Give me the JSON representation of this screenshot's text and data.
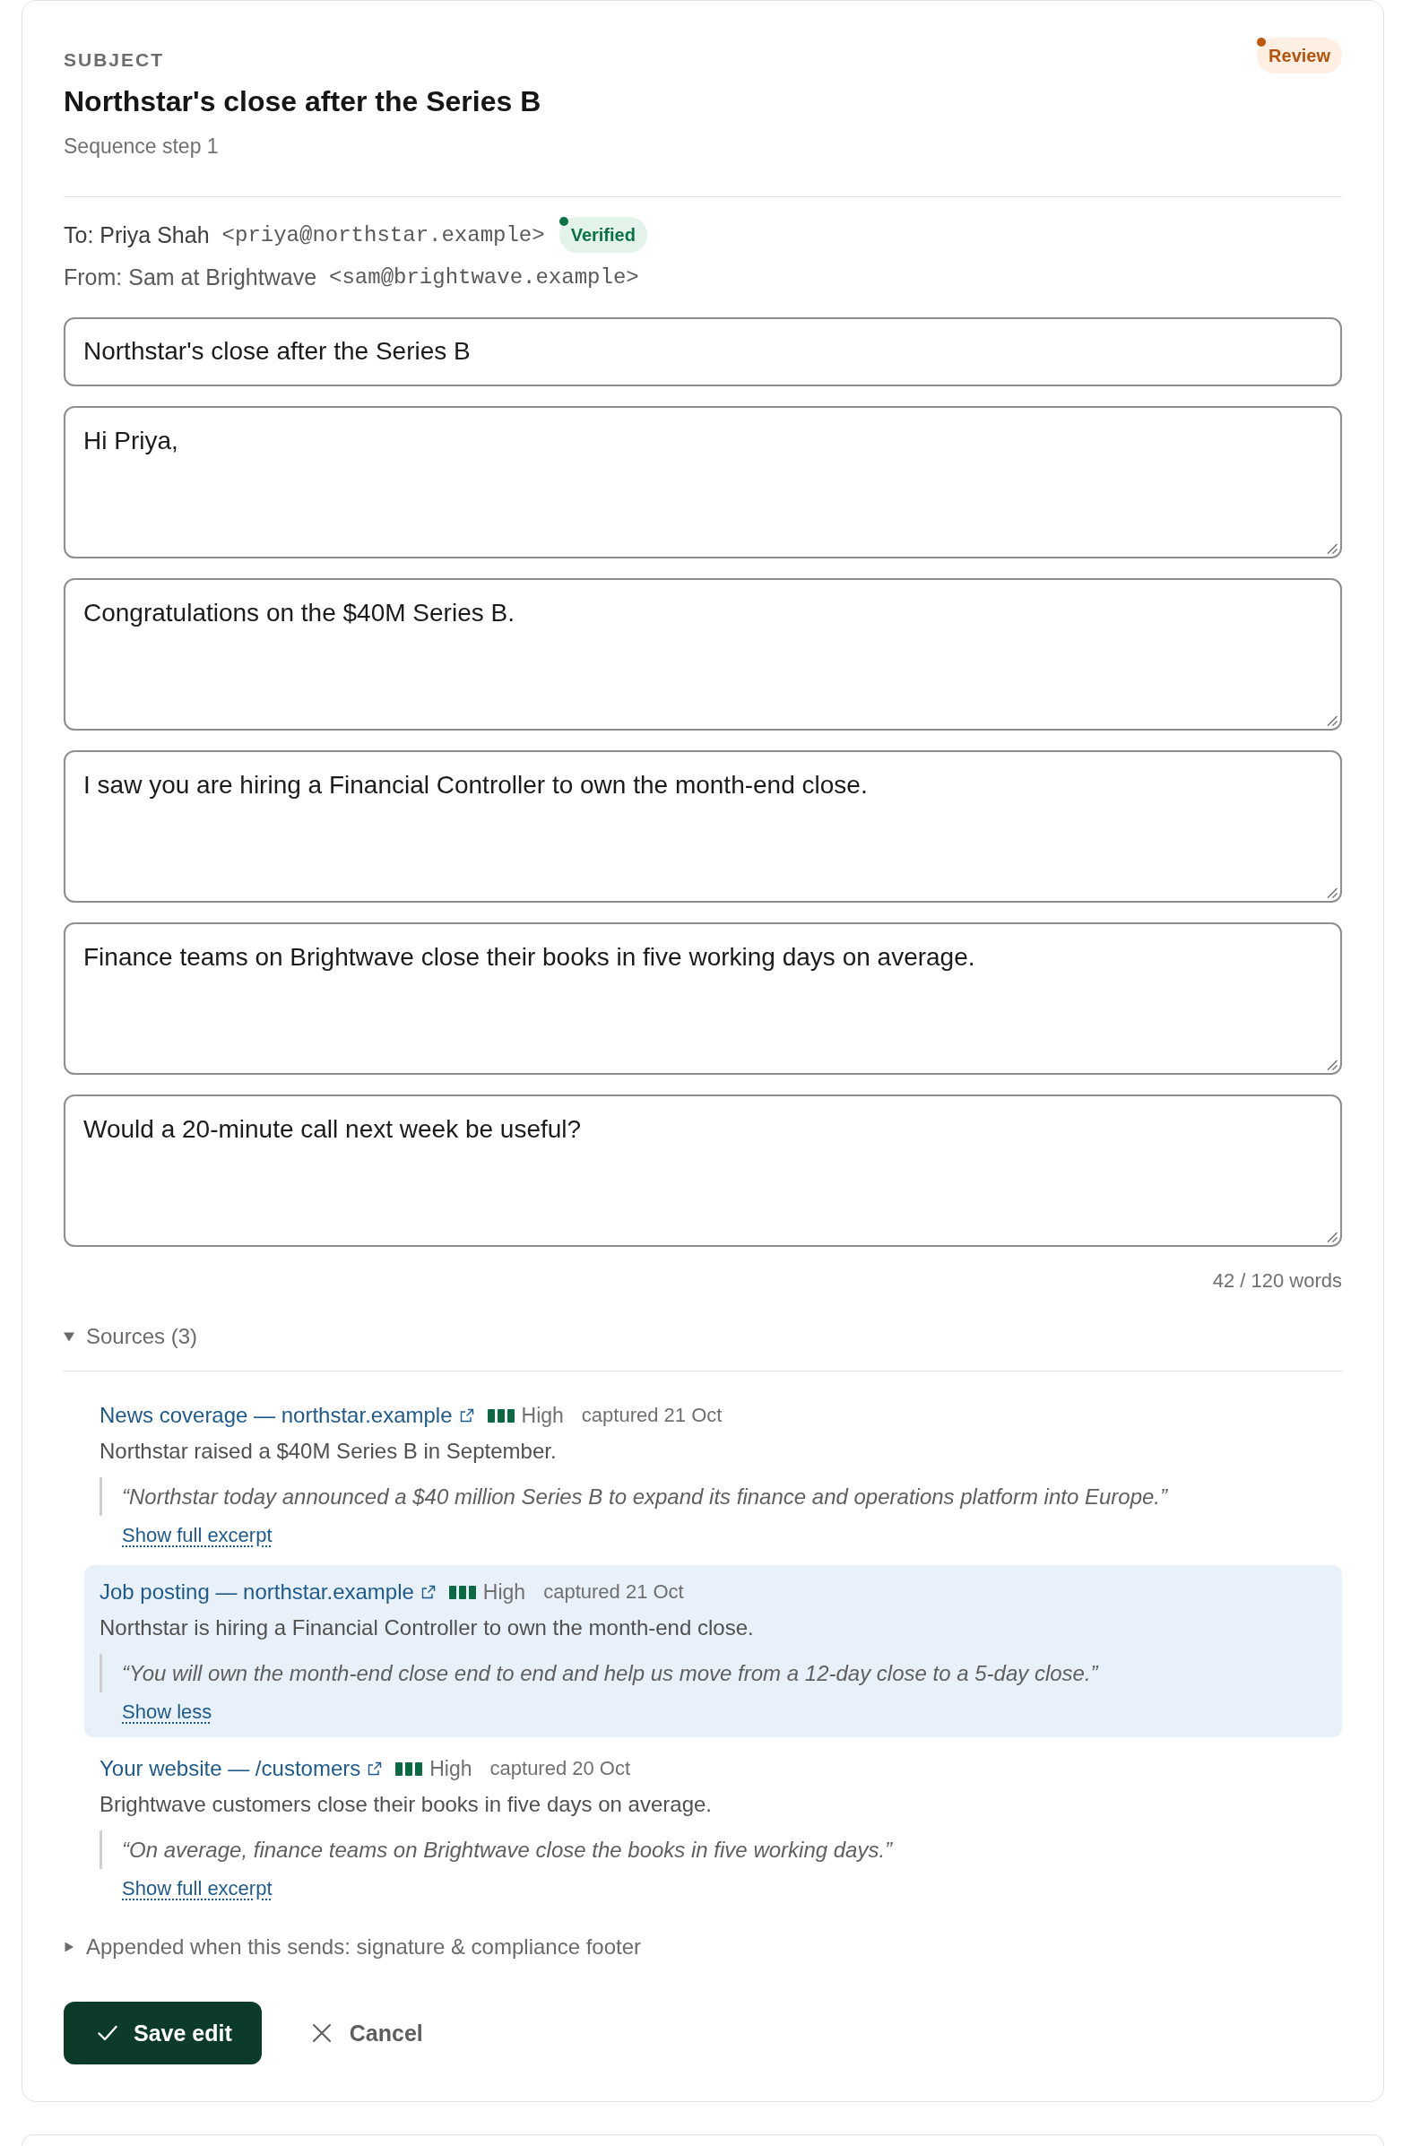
{
  "header": {
    "label": "SUBJECT",
    "title": "Northstar's close after the Series B",
    "subtitle": "Sequence step 1",
    "status": {
      "text": "Review",
      "kind": "review"
    }
  },
  "recipients": {
    "to": {
      "name": "To: Priya Shah",
      "email": "<priya@northstar.example>",
      "badge": {
        "text": "Verified",
        "kind": "verified"
      }
    },
    "from": {
      "name": "From: Sam at Brightwave",
      "email": "<sam@brightwave.example>"
    }
  },
  "subject_field": {
    "value": "Northstar's close after the Series B"
  },
  "paragraphs": [
    {
      "value": "Hi Priya,"
    },
    {
      "value": "Congratulations on the $40M Series B."
    },
    {
      "value": "I saw you are hiring a Financial Controller to own the month-end close."
    },
    {
      "value": "Finance teams on Brightwave close their books in five working days on average."
    },
    {
      "value": "Would a 20-minute call next week be useful?"
    }
  ],
  "word_count": "42 / 120 words",
  "sources": {
    "label": "Sources (3)",
    "expanded": true,
    "items": [
      {
        "title": "News coverage — northstar.example",
        "confidence": "High",
        "captured": "captured 21 Oct",
        "summary": "Northstar raised a $40M Series B in September.",
        "quote": "“Northstar today announced a $40 million Series B to expand its finance and operations platform into Europe.”",
        "toggle": "Show full excerpt",
        "expanded": false
      },
      {
        "title": "Job posting — northstar.example",
        "confidence": "High",
        "captured": "captured 21 Oct",
        "summary": "Northstar is hiring a Financial Controller to own the month-end close.",
        "quote": "“You will own the month-end close end to end and help us move from a 12-day close to a 5-day close.”",
        "toggle": "Show less",
        "expanded": true
      },
      {
        "title": "Your website — /customers",
        "confidence": "High",
        "captured": "captured 20 Oct",
        "summary": "Brightwave customers close their books in five days on average.",
        "quote": "“On average, finance teams on Brightwave close the books in five working days.”",
        "toggle": "Show full excerpt",
        "expanded": false
      }
    ]
  },
  "appended": {
    "label": "Appended when this sends: signature & compliance footer",
    "expanded": false
  },
  "actions": [
    {
      "label": "Save edit",
      "kind": "primary"
    },
    {
      "label": "Cancel",
      "kind": "secondary"
    }
  ]
}
